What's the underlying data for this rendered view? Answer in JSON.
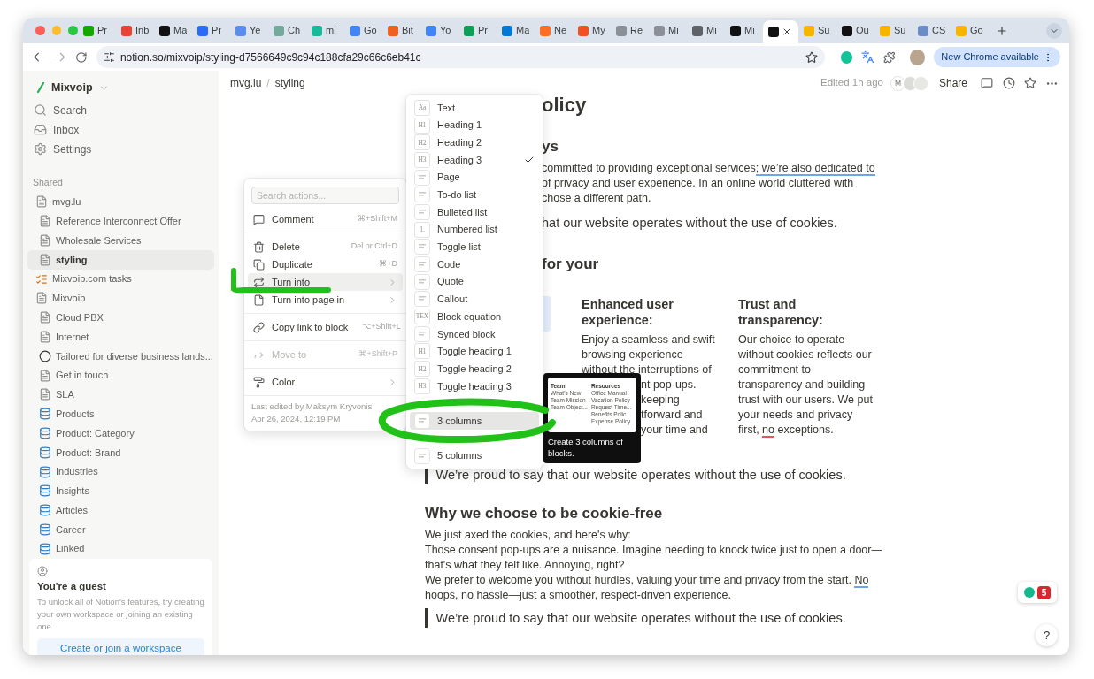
{
  "browser": {
    "tabs": [
      {
        "title": "Pr",
        "color": "#14a800",
        "selected": false
      },
      {
        "title": "Inb",
        "color": "#ea4335",
        "selected": false
      },
      {
        "title": "Ma",
        "color": "#111111",
        "selected": false
      },
      {
        "title": "Pr",
        "color": "#2a6cf6",
        "selected": false
      },
      {
        "title": "Ye",
        "color": "#5b8def",
        "selected": false
      },
      {
        "title": "Ch",
        "color": "#74aa9c",
        "selected": false
      },
      {
        "title": "mi",
        "color": "#1bb99a",
        "selected": false
      },
      {
        "title": "Go",
        "color": "#4285f4",
        "selected": false
      },
      {
        "title": "Bit",
        "color": "#ee6123",
        "selected": false
      },
      {
        "title": "Yo",
        "color": "#4285f4",
        "selected": false
      },
      {
        "title": "Pr",
        "color": "#0f9d58",
        "selected": false
      },
      {
        "title": "Ma",
        "color": "#0078d4",
        "selected": false
      },
      {
        "title": "Ne",
        "color": "#fc6d26",
        "selected": false
      },
      {
        "title": "My",
        "color": "#f25022",
        "selected": false
      },
      {
        "title": "Re",
        "color": "#8a8f98",
        "selected": false
      },
      {
        "title": "Mi",
        "color": "#8a8f98",
        "selected": false
      },
      {
        "title": "Mi",
        "color": "#5f6368",
        "selected": false
      },
      {
        "title": "Mi",
        "color": "#111111",
        "selected": false
      },
      {
        "color": "#111111",
        "selected": true
      },
      {
        "title": "Su",
        "color": "#f7b500",
        "selected": false
      },
      {
        "title": "Ou",
        "color": "#111111",
        "selected": false
      },
      {
        "title": "Su",
        "color": "#f7b500",
        "selected": false
      },
      {
        "title": "CS",
        "color": "#6b8cc7",
        "selected": false
      },
      {
        "title": "Go",
        "color": "#f7b500",
        "selected": false
      }
    ],
    "url": "notion.so/mixvoip/styling-d7566649c9c94c188cfa29c66c6eb41c",
    "update_button": "New Chrome available"
  },
  "sidebar": {
    "workspace": "Mixvoip",
    "nav": [
      {
        "kind": "search",
        "label": "Search"
      },
      {
        "kind": "inbox",
        "label": "Inbox"
      },
      {
        "kind": "settings",
        "label": "Settings"
      }
    ],
    "section": "Shared",
    "items": [
      {
        "label": "mvg.lu",
        "kind": "page",
        "selected": false,
        "children": [
          {
            "label": "Reference Interconnect Offer",
            "kind": "page",
            "selected": false
          },
          {
            "label": "Wholesale Services",
            "kind": "page",
            "selected": false
          },
          {
            "label": "styling",
            "kind": "page",
            "selected": true
          }
        ]
      },
      {
        "label": "Mixvoip.com tasks",
        "kind": "tasks",
        "selected": false
      },
      {
        "label": "Mixvoip",
        "kind": "page",
        "selected": false,
        "children": [
          {
            "label": "Cloud PBX",
            "kind": "page",
            "selected": false
          },
          {
            "label": "Internet",
            "kind": "page",
            "selected": false
          },
          {
            "label": "Tailored for diverse business lands...",
            "kind": "circle",
            "selected": false
          },
          {
            "label": "Get in touch",
            "kind": "page",
            "selected": false
          },
          {
            "label": "SLA",
            "kind": "page",
            "selected": false
          },
          {
            "label": "Products",
            "kind": "database",
            "selected": false
          },
          {
            "label": "Product: Category",
            "kind": "database",
            "selected": false
          },
          {
            "label": "Product: Brand",
            "kind": "database",
            "selected": false
          },
          {
            "label": "Industries",
            "kind": "database",
            "selected": false
          },
          {
            "label": "Insights",
            "kind": "database",
            "selected": false
          },
          {
            "label": "Articles",
            "kind": "database",
            "selected": false
          },
          {
            "label": "Career",
            "kind": "database",
            "selected": false
          },
          {
            "label": "Linked",
            "kind": "database",
            "selected": false
          }
        ]
      }
    ],
    "guest": {
      "title": "You're a guest",
      "text": "To unlock all of Notion's features, try creating your own workspace or joining an existing one",
      "button": "Create or join a workspace"
    }
  },
  "topbar": {
    "breadcrumb": [
      "mvg.lu",
      "styling"
    ],
    "separator": "/",
    "edited": "Edited 1h ago",
    "avatar": "M",
    "share": "Share"
  },
  "blocks": [
    {
      "kind": "title",
      "text": "olicy",
      "covered": true
    },
    {
      "kind": "heading",
      "text": "ys",
      "covered": true
    },
    {
      "kind": "paragraph",
      "covered": true,
      "lines": [
        {
          "segments": [
            {
              "text": "committed to providing exceptional services"
            },
            {
              "text": "; we’re also dedicated to",
              "color": "#6fa3ea"
            }
          ]
        },
        "of privacy and user experience. In an online world cluttered with",
        "chose a different path."
      ]
    },
    {
      "kind": "quote",
      "covered": true,
      "text": "hat our website operates without the use of cookies."
    },
    {
      "kind": "heading",
      "text": "for your",
      "covered": true
    },
    {
      "kind": "columns",
      "columns": [
        {
          "kind": "image"
        },
        {
          "kind": "text",
          "heading": "Enhanced user experience:",
          "lines": [
            "Enjoy a seamless and swift",
            "browsing experience",
            "without the interruptions of",
            {
              "text": "nt pop-ups.",
              "covered": true
            },
            {
              "text": "keeping",
              "covered": true
            },
            {
              "text": "tforward and",
              "covered": true
            },
            {
              "text": "your time and",
              "covered": true
            }
          ]
        },
        {
          "kind": "text",
          "heading": "Trust and transparency:",
          "lines": [
            "Our choice to operate",
            "without cookies reflects our",
            "commitment to",
            "transparency and building",
            "trust with our users. We put",
            "your needs and privacy",
            {
              "segments": [
                {
                  "text": "first, "
                },
                {
                  "text": "no",
                  "color": "#e5535d"
                },
                {
                  "text": " exceptions."
                }
              ]
            }
          ]
        }
      ]
    },
    {
      "kind": "quote",
      "text": "We’re proud to say that our website operates without the use of cookies."
    },
    {
      "kind": "heading",
      "text": "Why we choose to be cookie-free"
    },
    {
      "kind": "paragraph",
      "lines": [
        "We just axed the cookies, and here's why:",
        "Those consent pop-ups are a nuisance. Imagine needing to knock twice just to open a door—",
        "that's what they felt like. Annoying, right?",
        {
          "segments": [
            {
              "text": "We prefer to welcome you without hurdles, valuing your time and privacy from the start. "
            },
            {
              "text": "No",
              "color": "#6fa3ea"
            }
          ]
        },
        "hoops, no hassle—just a smoother, respect-driven experience."
      ]
    },
    {
      "kind": "quote",
      "text": "We’re proud to say that our website operates without the use of cookies."
    }
  ],
  "action_menu": {
    "placeholder": "Search actions...",
    "groups": [
      [
        {
          "kind": "comment",
          "label": "Comment",
          "shortcut": "⌘+Shift+M",
          "selected": false,
          "disabled": false
        }
      ],
      [
        {
          "kind": "delete",
          "label": "Delete",
          "shortcut": "Del or Ctrl+D",
          "selected": false,
          "disabled": false
        },
        {
          "kind": "duplicate",
          "label": "Duplicate",
          "shortcut": "⌘+D",
          "selected": false,
          "disabled": false
        },
        {
          "kind": "turn",
          "label": "Turn into",
          "submenu": true,
          "selected": true,
          "disabled": false
        },
        {
          "kind": "page",
          "label": "Turn into page in",
          "submenu": true,
          "selected": false,
          "disabled": false
        }
      ],
      [
        {
          "kind": "link",
          "label": "Copy link to block",
          "shortcut": "⌥+Shift+L",
          "selected": false,
          "disabled": false
        }
      ],
      [
        {
          "kind": "move",
          "label": "Move to",
          "shortcut": "⌘+Shift+P",
          "selected": false,
          "disabled": true
        }
      ],
      [
        {
          "kind": "color",
          "label": "Color",
          "submenu": true,
          "selected": false,
          "disabled": false
        }
      ]
    ],
    "footer": [
      "Last edited by Maksym Kryvonis",
      "Apr 26, 2024, 12:19 PM"
    ]
  },
  "turn_into_menu": [
    {
      "label": "Text",
      "glyph": "Aa",
      "checked": false,
      "selected": false
    },
    {
      "label": "Heading 1",
      "glyph": "H1",
      "checked": false,
      "selected": false
    },
    {
      "label": "Heading 2",
      "glyph": "H2",
      "checked": false,
      "selected": false
    },
    {
      "label": "Heading 3",
      "glyph": "H3",
      "checked": true,
      "selected": false
    },
    {
      "label": "Page",
      "checked": false,
      "selected": false
    },
    {
      "label": "To-do list",
      "checked": false,
      "selected": false
    },
    {
      "label": "Bulleted list",
      "checked": false,
      "selected": false
    },
    {
      "label": "Numbered list",
      "glyph": "1.",
      "checked": false,
      "selected": false
    },
    {
      "label": "Toggle list",
      "checked": false,
      "selected": false
    },
    {
      "label": "Code",
      "checked": false,
      "selected": false
    },
    {
      "label": "Quote",
      "checked": false,
      "selected": false
    },
    {
      "label": "Callout",
      "checked": false,
      "selected": false
    },
    {
      "label": "Block equation",
      "glyph": "TEX",
      "checked": false,
      "selected": false
    },
    {
      "label": "Synced block",
      "checked": false,
      "selected": false
    },
    {
      "label": "Toggle heading 1",
      "glyph": "H1",
      "checked": false,
      "selected": false
    },
    {
      "label": "Toggle heading 2",
      "glyph": "H2",
      "checked": false,
      "selected": false
    },
    {
      "label": "Toggle heading 3",
      "glyph": "H3",
      "checked": false,
      "selected": false
    },
    {
      "checked": false,
      "selected": false
    },
    {
      "label": "3 columns",
      "checked": false,
      "selected": true
    },
    {
      "checked": false,
      "selected": false
    },
    {
      "label": "5 columns",
      "checked": false,
      "selected": false
    }
  ],
  "tooltip": {
    "preview": [
      {
        "title": "Team",
        "items": [
          "What's New",
          "Team Mission",
          "Team Object..."
        ]
      },
      {
        "title": "Resources",
        "items": [
          "Office Manual",
          "Vacation Policy",
          "Request Time...",
          "Benefits Polic...",
          "Expense Policy"
        ]
      }
    ],
    "text": "Create 3 columns of blocks."
  },
  "widget": {
    "badge": "5"
  },
  "help": "?"
}
